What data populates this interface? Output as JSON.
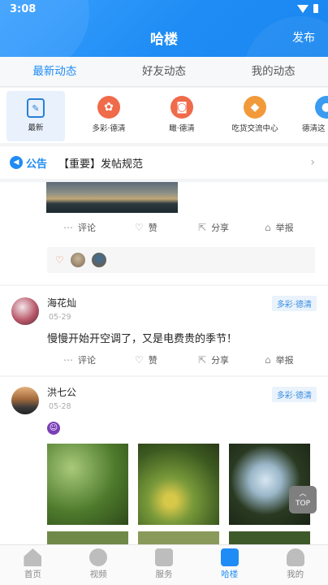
{
  "status": {
    "time": "3:08"
  },
  "header": {
    "title": "哈楼",
    "publish": "发布"
  },
  "tabs": [
    {
      "label": "最新动态",
      "active": true
    },
    {
      "label": "好友动态",
      "active": false
    },
    {
      "label": "我的动态",
      "active": false
    }
  ],
  "categories": [
    {
      "label": "最新",
      "icon": "clipboard-icon",
      "color": "#2a7fd6",
      "active": true
    },
    {
      "label": "多彩·德清",
      "icon": "palette-icon",
      "color": "#ef6b4a"
    },
    {
      "label": "瞰·德清",
      "icon": "camera-icon",
      "color": "#ef6b4a"
    },
    {
      "label": "吃货交流中心",
      "icon": "food-icon",
      "color": "#f29a3a"
    },
    {
      "label": "德清这",
      "icon": "topic-icon",
      "color": "#3a9cf0"
    }
  ],
  "notice": {
    "badge": "公告",
    "text": "【重要】发帖规范"
  },
  "actions": {
    "comment": "评论",
    "like": "赞",
    "share": "分享",
    "report": "举报"
  },
  "posts": [
    {
      "user": "海花灿",
      "date": "05-29",
      "tag": "多彩·德清",
      "content": "慢慢开始开空调了，又是电费贵的季节！"
    },
    {
      "user": "洪七公",
      "date": "05-28",
      "tag": "多彩·德清"
    }
  ],
  "top_button": "TOP",
  "bottom_nav": [
    {
      "label": "首页",
      "icon": "home-icon",
      "active": false
    },
    {
      "label": "视频",
      "icon": "play-icon",
      "active": false
    },
    {
      "label": "服务",
      "icon": "grid-icon",
      "active": false
    },
    {
      "label": "哈楼",
      "icon": "halou-icon",
      "active": true
    },
    {
      "label": "我的",
      "icon": "user-icon",
      "active": false
    }
  ],
  "colors": {
    "accent": "#1e8cf4",
    "tag_bg": "#eaf3fc"
  }
}
